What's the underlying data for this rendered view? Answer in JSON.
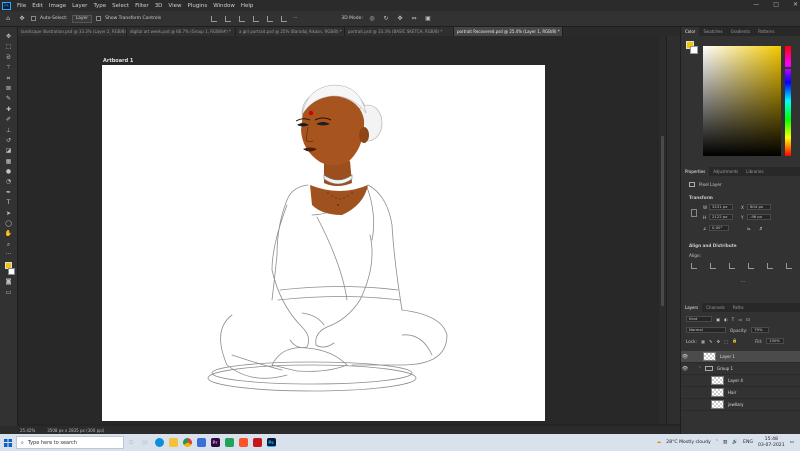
{
  "app": {
    "menu": [
      "File",
      "Edit",
      "Image",
      "Layer",
      "Type",
      "Select",
      "Filter",
      "3D",
      "View",
      "Plugins",
      "Window",
      "Help"
    ],
    "window_controls": [
      "—",
      "□",
      "✕"
    ]
  },
  "options_bar": {
    "auto_select_label": "Auto-Select:",
    "auto_select_value": "Layer",
    "transform_label": "Show Transform Controls",
    "mode_3d_label": "3D Mode:"
  },
  "tabs": [
    "landscape illustration.psd @ 33.3% (Layer 2, RGB/8) *",
    "digital art week.psd @ 66.7% (Group 1, RGB/8#) *",
    "a girl portrait.psd @ 25% (Baradaj Aikasn, RGB/8) *",
    "portrait.psd @ 33.3% (BASIC SKETCH, RGB/8) *",
    "portrait Recovered.psd @ 25.4% (Layer 1, RGB/8) *"
  ],
  "active_tab_index": 4,
  "artboard": {
    "label": "Artboard 1"
  },
  "status": {
    "zoom": "25.42%",
    "doc_size": "3508 px x 2835 px (300 ppi)"
  },
  "right_panel": {
    "color_tabs": [
      "Color",
      "Swatches",
      "Gradients",
      "Patterns"
    ],
    "properties_tabs": [
      "Properties",
      "Adjustments",
      "Libraries"
    ],
    "layer_type": "Pixel Layer",
    "transform_title": "Transform",
    "w_label": "W",
    "w_value": "3231 px",
    "h_label": "H",
    "h_value": "2122 px",
    "x_label": "X",
    "x_value": "604 px",
    "y_label": "Y",
    "y_value": "-96 px",
    "angle_value": "0.00°",
    "align_title": "Align and Distribute",
    "align_label": "Align:",
    "layers_tabs": [
      "Layers",
      "Channels",
      "Paths"
    ],
    "kind_label": "Kind",
    "blend_mode": "Normal",
    "opacity_label": "Opacity:",
    "opacity_value": "79%",
    "lock_label": "Lock:",
    "fill_label": "Fill:",
    "fill_value": "100%",
    "layers": [
      {
        "name": "Layer 1",
        "selected": true,
        "visible": true,
        "indent": 0
      },
      {
        "name": "Group 1",
        "selected": false,
        "visible": true,
        "indent": 0,
        "group": true
      },
      {
        "name": "Layer 4",
        "selected": false,
        "visible": false,
        "indent": 1
      },
      {
        "name": "Hair",
        "selected": false,
        "visible": false,
        "indent": 1
      },
      {
        "name": "jewllary",
        "selected": false,
        "visible": false,
        "indent": 1
      }
    ]
  },
  "taskbar": {
    "search_placeholder": "Type here to search",
    "weather": "28°C  Mostly cloudy",
    "lang": "ENG",
    "time": "15:48",
    "date": "03-07-2021"
  },
  "colors": {
    "accent": "#31a8ff",
    "foreground_swatch": "#f2c500",
    "skin": "#a0521e"
  }
}
